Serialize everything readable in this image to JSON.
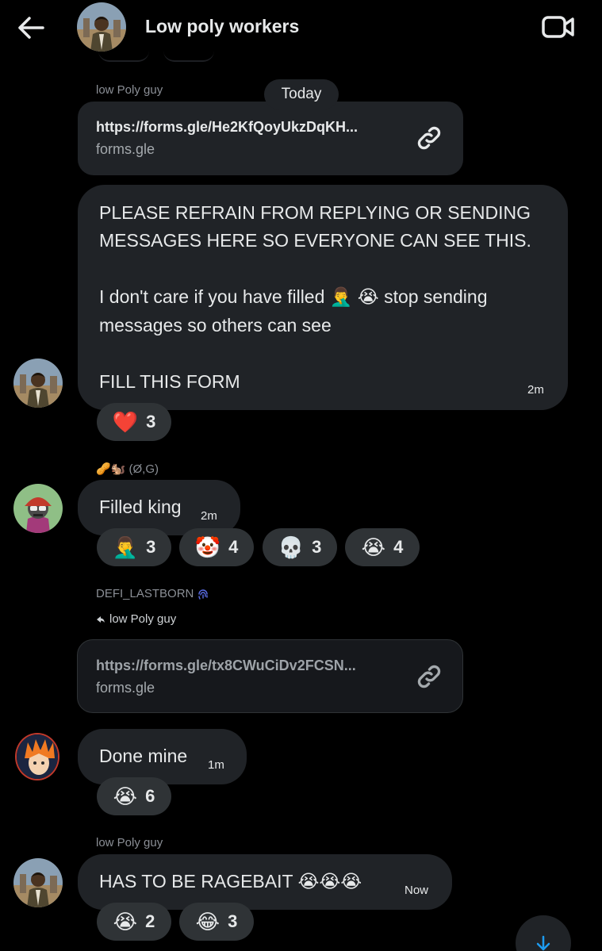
{
  "header": {
    "title": "Low poly workers",
    "back_icon": "arrow-left-icon",
    "video_icon": "video-camera-icon"
  },
  "date_separator": "Today",
  "messages": [
    {
      "sender": "low Poly guy",
      "link": {
        "url": "https://forms.gle/He2KfQoyUkzDqKH...",
        "domain": "forms.gle"
      }
    },
    {
      "lines": [
        "PLEASE REFRAIN FROM REPLYING OR SENDING",
        "MESSAGES HERE SO EVERYONE CAN SEE THIS.",
        "",
        "I don't care if you have filled 🤦‍♂️ 😭  stop sending",
        "messages so others can see",
        "",
        "FILL THIS FORM"
      ],
      "time": "2m",
      "reactions": [
        {
          "emoji": "❤️",
          "count": "3"
        }
      ]
    },
    {
      "sender": "🥜🐿️ (Ø,G)",
      "text": "Filled king",
      "time": "2m",
      "reactions": [
        {
          "emoji": "🤦‍♂️",
          "count": "3"
        },
        {
          "emoji": "🤡",
          "count": "4"
        },
        {
          "emoji": "💀",
          "count": "3"
        },
        {
          "emoji": "😭",
          "count": "4"
        }
      ]
    },
    {
      "sender": "DEFI_LASTBORN",
      "reply_to": "low Poly guy",
      "link": {
        "url": "https://forms.gle/tx8CWuCiDv2FCSN...",
        "domain": "forms.gle"
      }
    },
    {
      "text": "Done mine",
      "time": "1m",
      "reactions": [
        {
          "emoji": "😭",
          "count": "6"
        }
      ]
    },
    {
      "sender": "low Poly guy",
      "text": "HAS TO BE RAGEBAIT 😭😭😭",
      "time": "Now",
      "reactions": [
        {
          "emoji": "😭",
          "count": "2"
        },
        {
          "emoji": "😂",
          "count": "3"
        }
      ]
    }
  ],
  "scroll_down_icon": "arrow-down-icon",
  "colors": {
    "background": "#000000",
    "bubble": "#202327",
    "reaction": "#2f3336",
    "accent": "#1d9bf0"
  }
}
